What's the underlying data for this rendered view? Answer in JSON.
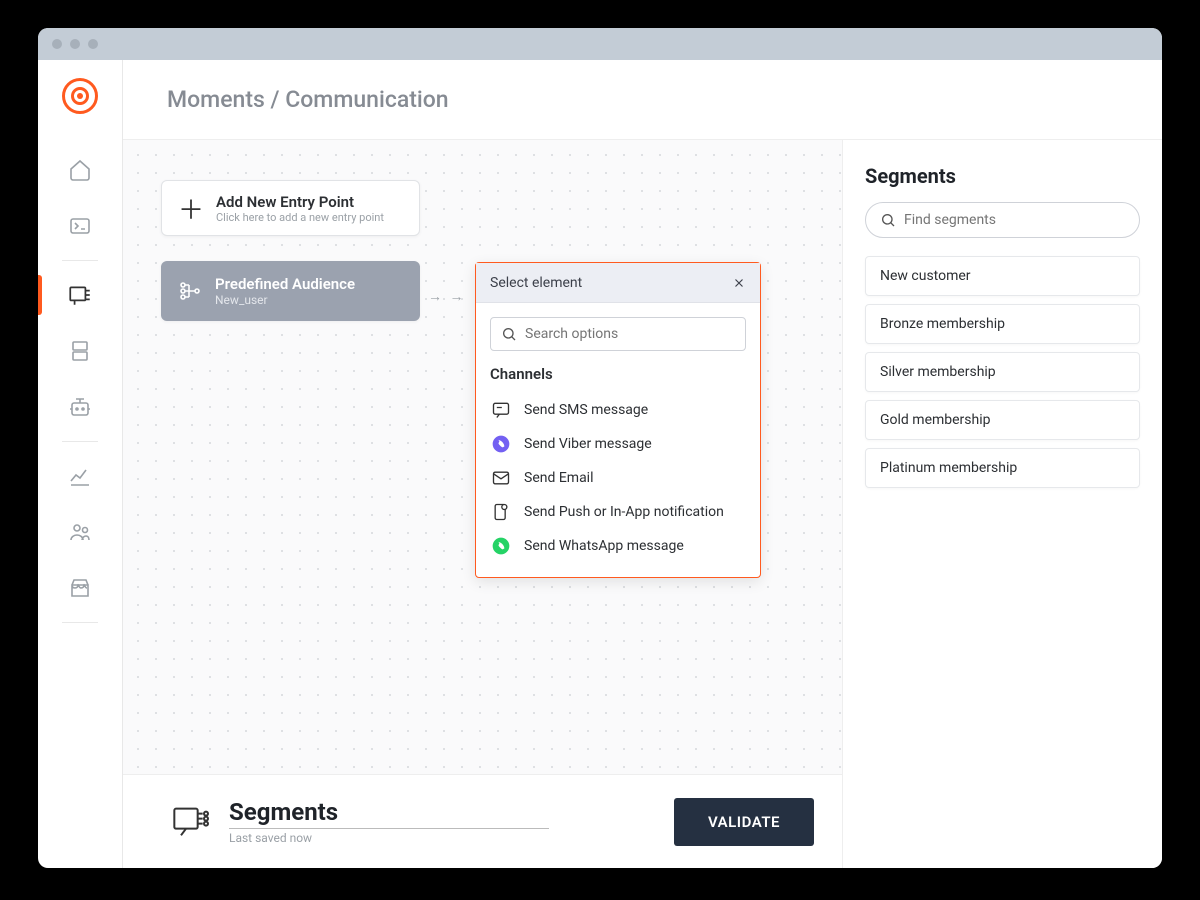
{
  "breadcrumb": "Moments / Communication",
  "entry_card": {
    "title": "Add New Entry Point",
    "subtitle": "Click here to add a new entry point"
  },
  "audience_card": {
    "title": "Predefined Audience",
    "subtitle": "New_user"
  },
  "popup": {
    "title": "Select element",
    "search_placeholder": "Search options",
    "section": "Channels",
    "channels": [
      {
        "label": "Send SMS message"
      },
      {
        "label": "Send Viber message"
      },
      {
        "label": "Send Email"
      },
      {
        "label": "Send Push or In-App notification"
      },
      {
        "label": "Send WhatsApp message"
      }
    ]
  },
  "right_panel": {
    "title": "Segments",
    "search_placeholder": "Find segments",
    "items": [
      "New customer",
      "Bronze membership",
      "Silver membership",
      "Gold membership",
      "Platinum membership"
    ]
  },
  "footer": {
    "title": "Segments",
    "subtitle": "Last saved now",
    "button": "VALIDATE"
  }
}
